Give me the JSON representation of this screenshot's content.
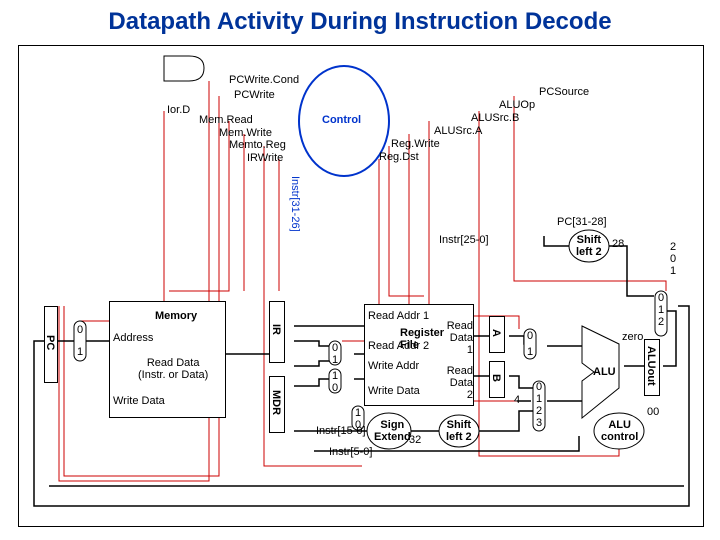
{
  "title": "Datapath Activity During Instruction Decode",
  "control_signals": {
    "pcwrite_cond": "PCWrite.Cond",
    "pcwrite": "PCWrite",
    "iord": "Ior.D",
    "memread": "Mem.Read",
    "memwrite": "Mem.Write",
    "memtoreg": "Memto.Reg",
    "irwrite": "IRWrite",
    "pcsource": "PCSource",
    "aluop": "ALUOp",
    "alusrcb": "ALUSrc.B",
    "alusrca": "ALUSrc.A",
    "regwrite": "Reg.Write",
    "regdst": "Reg.Dst"
  },
  "blocks": {
    "control": "Control",
    "pc": "PC",
    "memory": "Memory",
    "address": "Address",
    "read_data": "Read Data\n(Instr. or Data)",
    "write_data_mem": "Write Data",
    "ir": "IR",
    "mdr": "MDR",
    "regfile": "Register\nFile",
    "read_addr1": "Read Addr 1",
    "read_addr2": "Read Addr 2",
    "write_addr": "Write Addr",
    "write_data_rf": "Write Data",
    "read_data1": "Read\nData 1",
    "read_data2": "Read\nData 2",
    "a": "A",
    "b": "B",
    "alu": "ALU",
    "zero": "zero",
    "aluout": "ALUout",
    "sign_extend": "Sign\nExtend",
    "shift_left2_a": "Shift\nleft 2",
    "shift_left2_b": "Shift\nleft 2",
    "alu_control": "ALU\ncontrol"
  },
  "wires": {
    "instr31_26": "Instr[31-26]",
    "instr25_0": "Instr[25-0]",
    "instr15_0": "Instr[15-0]",
    "instr5_0": "Instr[5-0]",
    "pc31_28": "PC[31-28]"
  },
  "mux": {
    "m0": "0",
    "m1": "1",
    "m2": "2",
    "m3": "3"
  },
  "consts": {
    "four": "4",
    "twentyeight": "28",
    "thirtytwo": "32",
    "zerozero": "00"
  }
}
